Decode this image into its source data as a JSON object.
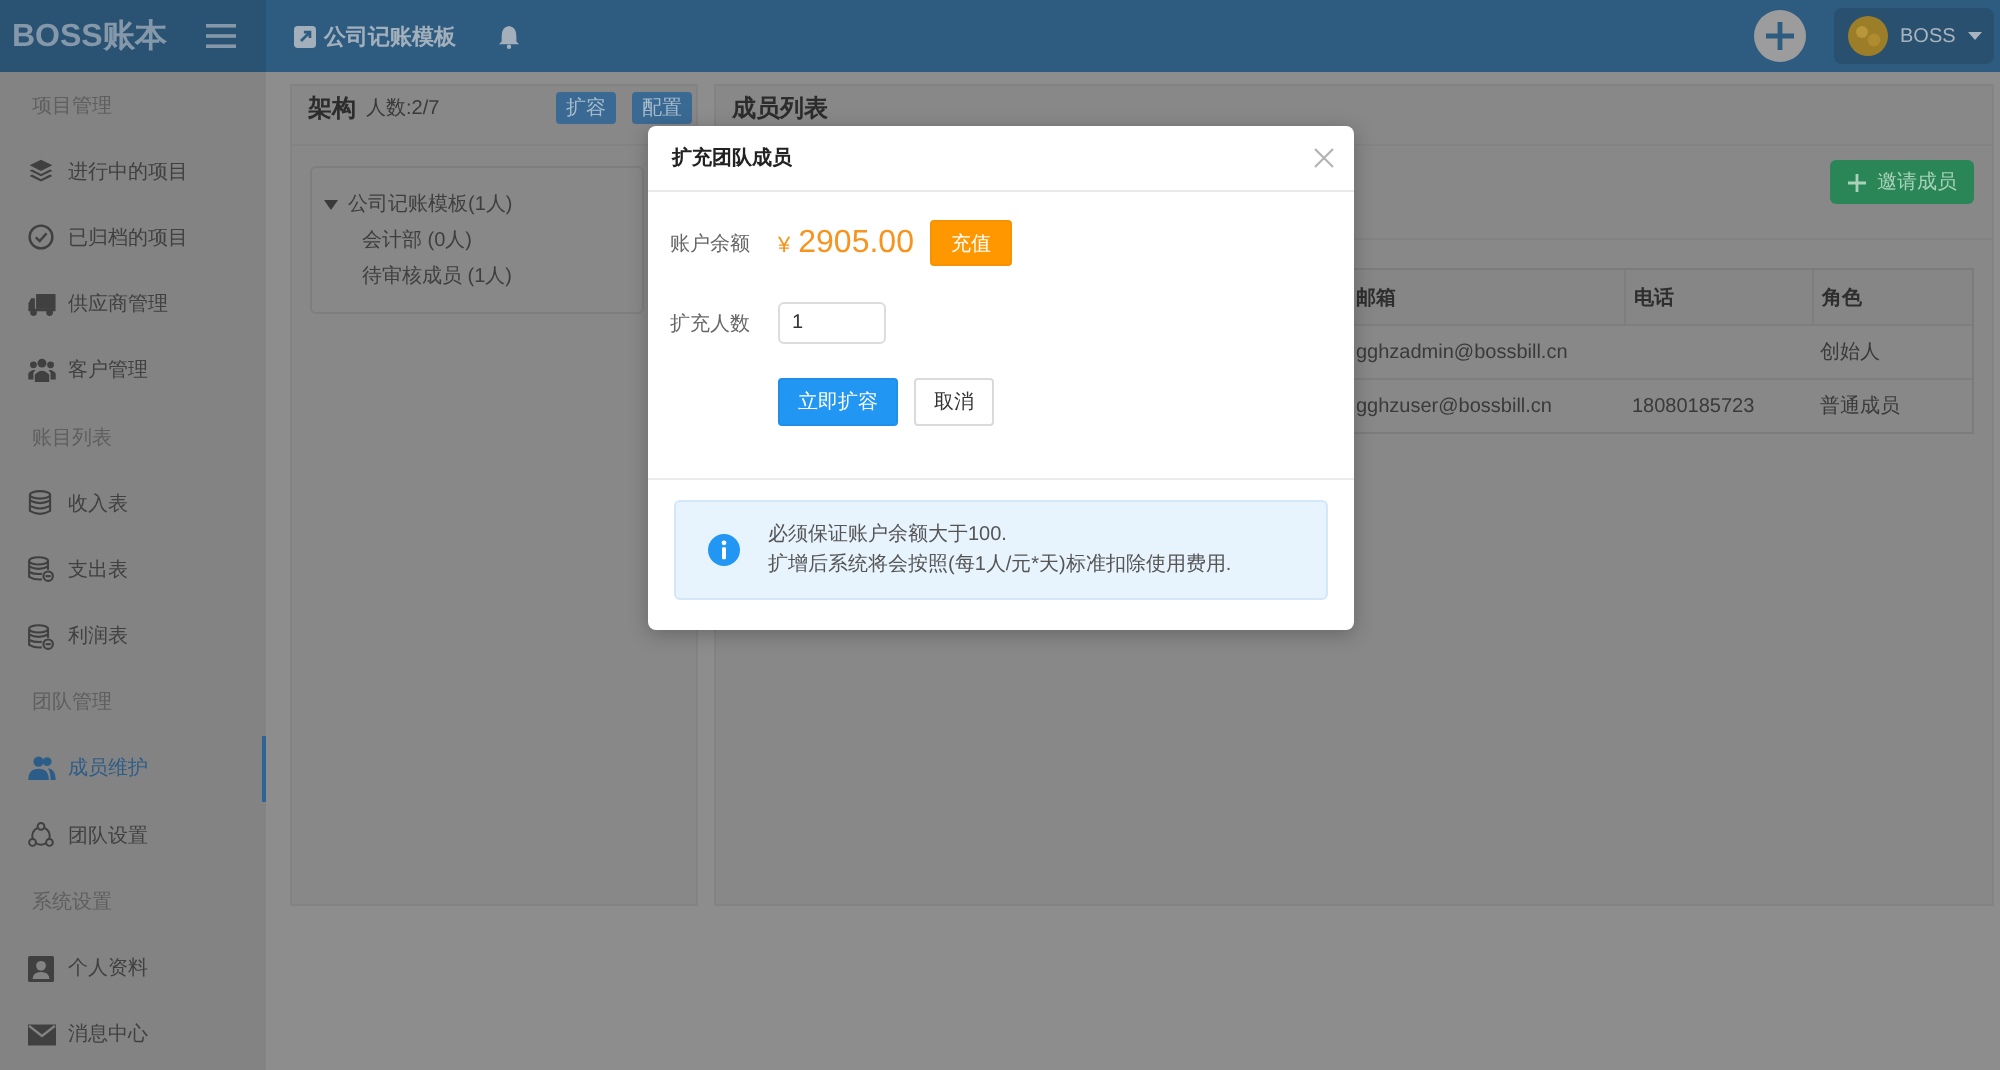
{
  "topbar": {
    "logo": "BOSS账本",
    "project_link": "公司记账模板",
    "user": "BOSS"
  },
  "sidebar": {
    "sections": [
      {
        "title": "项目管理",
        "items": [
          {
            "label": "进行中的项目",
            "selected": false
          },
          {
            "label": "已归档的项目",
            "selected": false
          },
          {
            "label": "供应商管理",
            "selected": false
          },
          {
            "label": "客户管理",
            "selected": false
          }
        ]
      },
      {
        "title": "账目列表",
        "items": [
          {
            "label": "收入表",
            "selected": false
          },
          {
            "label": "支出表",
            "selected": false
          },
          {
            "label": "利润表",
            "selected": false
          }
        ]
      },
      {
        "title": "团队管理",
        "items": [
          {
            "label": "成员维护",
            "selected": true
          },
          {
            "label": "团队设置",
            "selected": false
          }
        ]
      },
      {
        "title": "系统设置",
        "items": [
          {
            "label": "个人资料",
            "selected": false
          },
          {
            "label": "消息中心",
            "selected": false
          }
        ]
      }
    ]
  },
  "structure_panel": {
    "title": "架构",
    "member_count": "人数:2/7",
    "buttons": [
      "扩容",
      "配置"
    ],
    "tree": [
      {
        "label": "公司记账模板(1人)",
        "expanded": true,
        "children": [
          {
            "label": "会计部 (0人)"
          },
          {
            "label": "待审核成员 (1人)"
          }
        ]
      }
    ]
  },
  "members_panel": {
    "title": "成员列表",
    "invite_button": "邀请成员",
    "table": {
      "columns": [
        "邮箱",
        "电话",
        "角色"
      ],
      "rows": [
        {
          "email": "gghzadmin@bossbill.cn",
          "role": "创始人"
        },
        {
          "email": "gghzuser@bossbill.cn",
          "phone": "18080185723",
          "role": "普通成员"
        }
      ]
    }
  },
  "modal": {
    "title": "扩充团队成员",
    "balance_label": "账户余额",
    "currency": "¥",
    "balance": "2905.00",
    "recharge_button": "充值",
    "count_label": "扩充人数",
    "count_value": "1",
    "confirm_button": "立即扩容",
    "cancel_button": "取消",
    "notes": [
      "必须保证账户余额大于100.",
      "扩增后系统将会按照(每1人/元*天)标准扣除使用费用."
    ]
  }
}
